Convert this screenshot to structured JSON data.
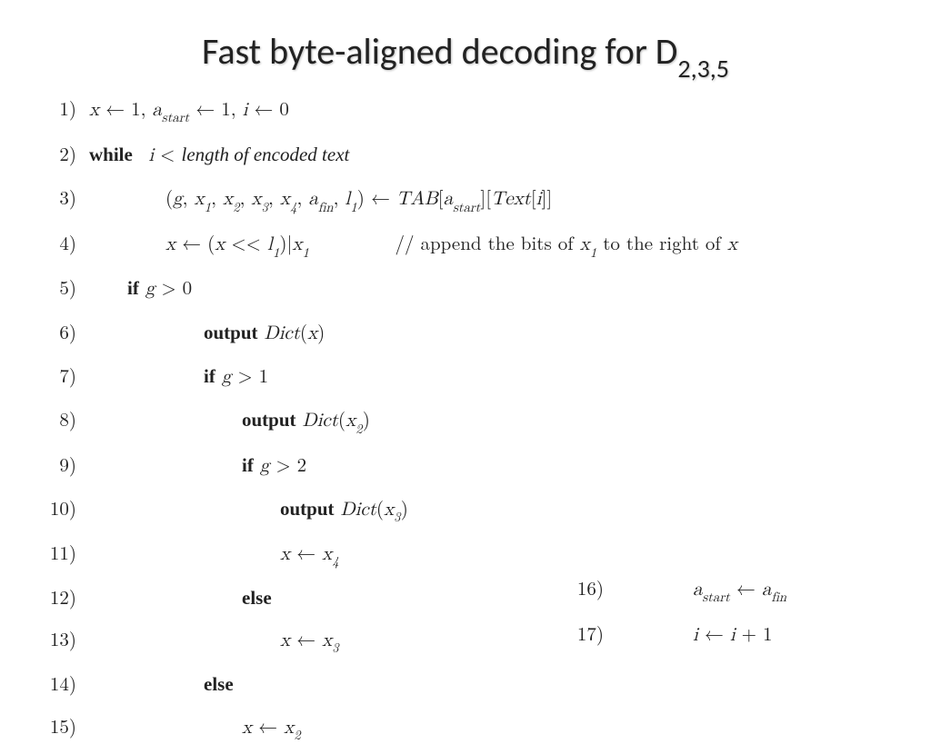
{
  "title_base": "Fast byte-aligned decoding for D",
  "title_sub": "2,3,5",
  "algorithm": {
    "lines": [
      {
        "n": "1)",
        "indent": 0,
        "html": "<span class='math'>x</span> ← 1, <span class='math'>a<span class='subm'>start</span></span> ← 1, <span class='math'>i</span> ← 0"
      },
      {
        "n": "2)",
        "indent": 0,
        "html": "<span class='bold'>while</span>&nbsp; <span class='math'>i</span> &lt; <span class='it'>length of encoded text</span>"
      },
      {
        "n": "3)",
        "indent": 2,
        "html": "(<span class='math'>g</span>, <span class='math'>x</span><span class='subm'>1</span>, <span class='math'>x</span><span class='subm'>2</span>, <span class='math'>x</span><span class='subm'>3</span>, <span class='math'>x</span><span class='subm'>4</span>, <span class='math'>a<span class='subm'>fin</span></span>, <span class='math'>l</span><span class='subm'>1</span>) ← <span class='math'>TAB</span>[<span class='math'>a<span class='subm'>start</span></span>][<span class='math'>Text</span>[<span class='math'>i</span>]]"
      },
      {
        "n": "4)",
        "indent": 2,
        "html": "<span class='math'>x</span> ← (<span class='math'>x</span> &lt;&lt; <span class='math'>l</span><span class='subm'>1</span>)|<span class='math'>x</span><span class='subm'>1</span>&nbsp;&nbsp;&nbsp;&nbsp;&nbsp;&nbsp;&nbsp;&nbsp;&nbsp;// append the bits of <span class='math'>x</span><span class='subm'>1</span> to the right of <span class='math'>x</span>"
      },
      {
        "n": "5)",
        "indent": 1,
        "html": "<span class='bold'>if</span> <span class='math'>g</span> &gt; 0"
      },
      {
        "n": "6)",
        "indent": 3,
        "html": "<span class='bold'>output</span> <span class='math'>Dict</span>(<span class='math'>x</span>)"
      },
      {
        "n": "7)",
        "indent": 3,
        "html": "<span class='bold'>if</span> <span class='math'>g</span> &gt; 1"
      },
      {
        "n": "8)",
        "indent": 4,
        "html": "<span class='bold'>output</span> <span class='math'>Dict</span>(<span class='math'>x</span><span class='subm'>2</span>)"
      },
      {
        "n": "9)",
        "indent": 4,
        "html": "<span class='bold'>if</span> <span class='math'>g</span> &gt; 2"
      },
      {
        "n": "10)",
        "indent": 5,
        "html": "<span class='bold'>output</span> <span class='math'>Dict</span>(<span class='math'>x</span><span class='subm'>3</span>)"
      },
      {
        "n": "11)",
        "indent": 5,
        "html": "<span class='math'>x</span> ← <span class='math'>x</span><span class='subm'>4</span>"
      },
      {
        "n": "12)",
        "indent": 4,
        "html": "<span class='bold'>else</span>"
      },
      {
        "n": "13)",
        "indent": 5,
        "html": "<span class='math'>x</span> ← <span class='math'>x</span><span class='subm'>3</span>"
      },
      {
        "n": "14)",
        "indent": 3,
        "html": "<span class='bold'>else</span>"
      },
      {
        "n": "15)",
        "indent": 4,
        "html": "<span class='math'>x</span> ← <span class='math'>x</span><span class='subm'>2</span>"
      }
    ],
    "side_lines": [
      {
        "n": "16)",
        "indent": 2,
        "html": "<span class='math'>a<span class='subm'>start</span></span> ← <span class='math'>a<span class='subm'>fin</span></span>"
      },
      {
        "n": "17)",
        "indent": 2,
        "html": "<span class='math'>i</span> ← <span class='math'>i</span> + 1"
      }
    ]
  }
}
